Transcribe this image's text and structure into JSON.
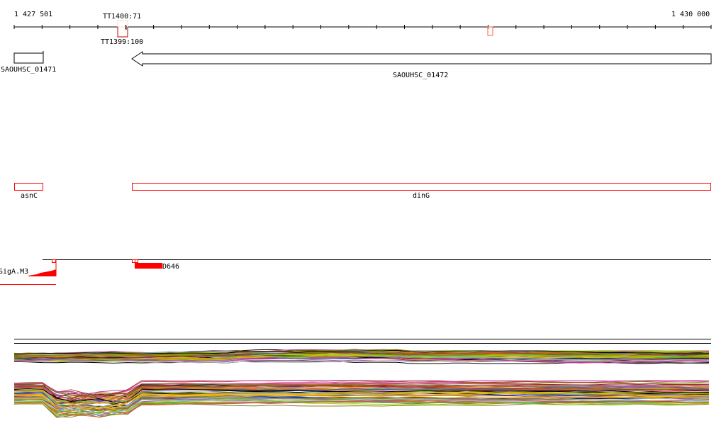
{
  "ruler": {
    "start_label": "1 427 501",
    "end_label": "1 430 000",
    "tick_count": 25
  },
  "terminators": [
    {
      "label": "TT1400:71",
      "color": "#ffd8c8"
    },
    {
      "label": "TT1399:100",
      "color": "#c00000"
    },
    {
      "label": "",
      "color": "#ff6040"
    }
  ],
  "genes": [
    {
      "label": "SAOUHSC_01471",
      "strand": "+"
    },
    {
      "label": "SAOUHSC_01472",
      "strand": "-"
    }
  ],
  "gene_names": [
    {
      "label": "asnC"
    },
    {
      "label": "dinG"
    }
  ],
  "motifs": [
    {
      "label": "SigA.M3"
    },
    {
      "label": "D646"
    }
  ],
  "colors": {
    "feature": "#ff0000",
    "outline": "#000000"
  },
  "expression_palette": [
    "#000000",
    "#8b7d2b",
    "#6fa8dc",
    "#a05aa0",
    "#e06030",
    "#7ec800",
    "#c0c0c0",
    "#ffb000",
    "#6a3d2a",
    "#d05080",
    "#3060c0",
    "#9ad000",
    "#b04020",
    "#808000",
    "#c040a0",
    "#40a0a0"
  ]
}
